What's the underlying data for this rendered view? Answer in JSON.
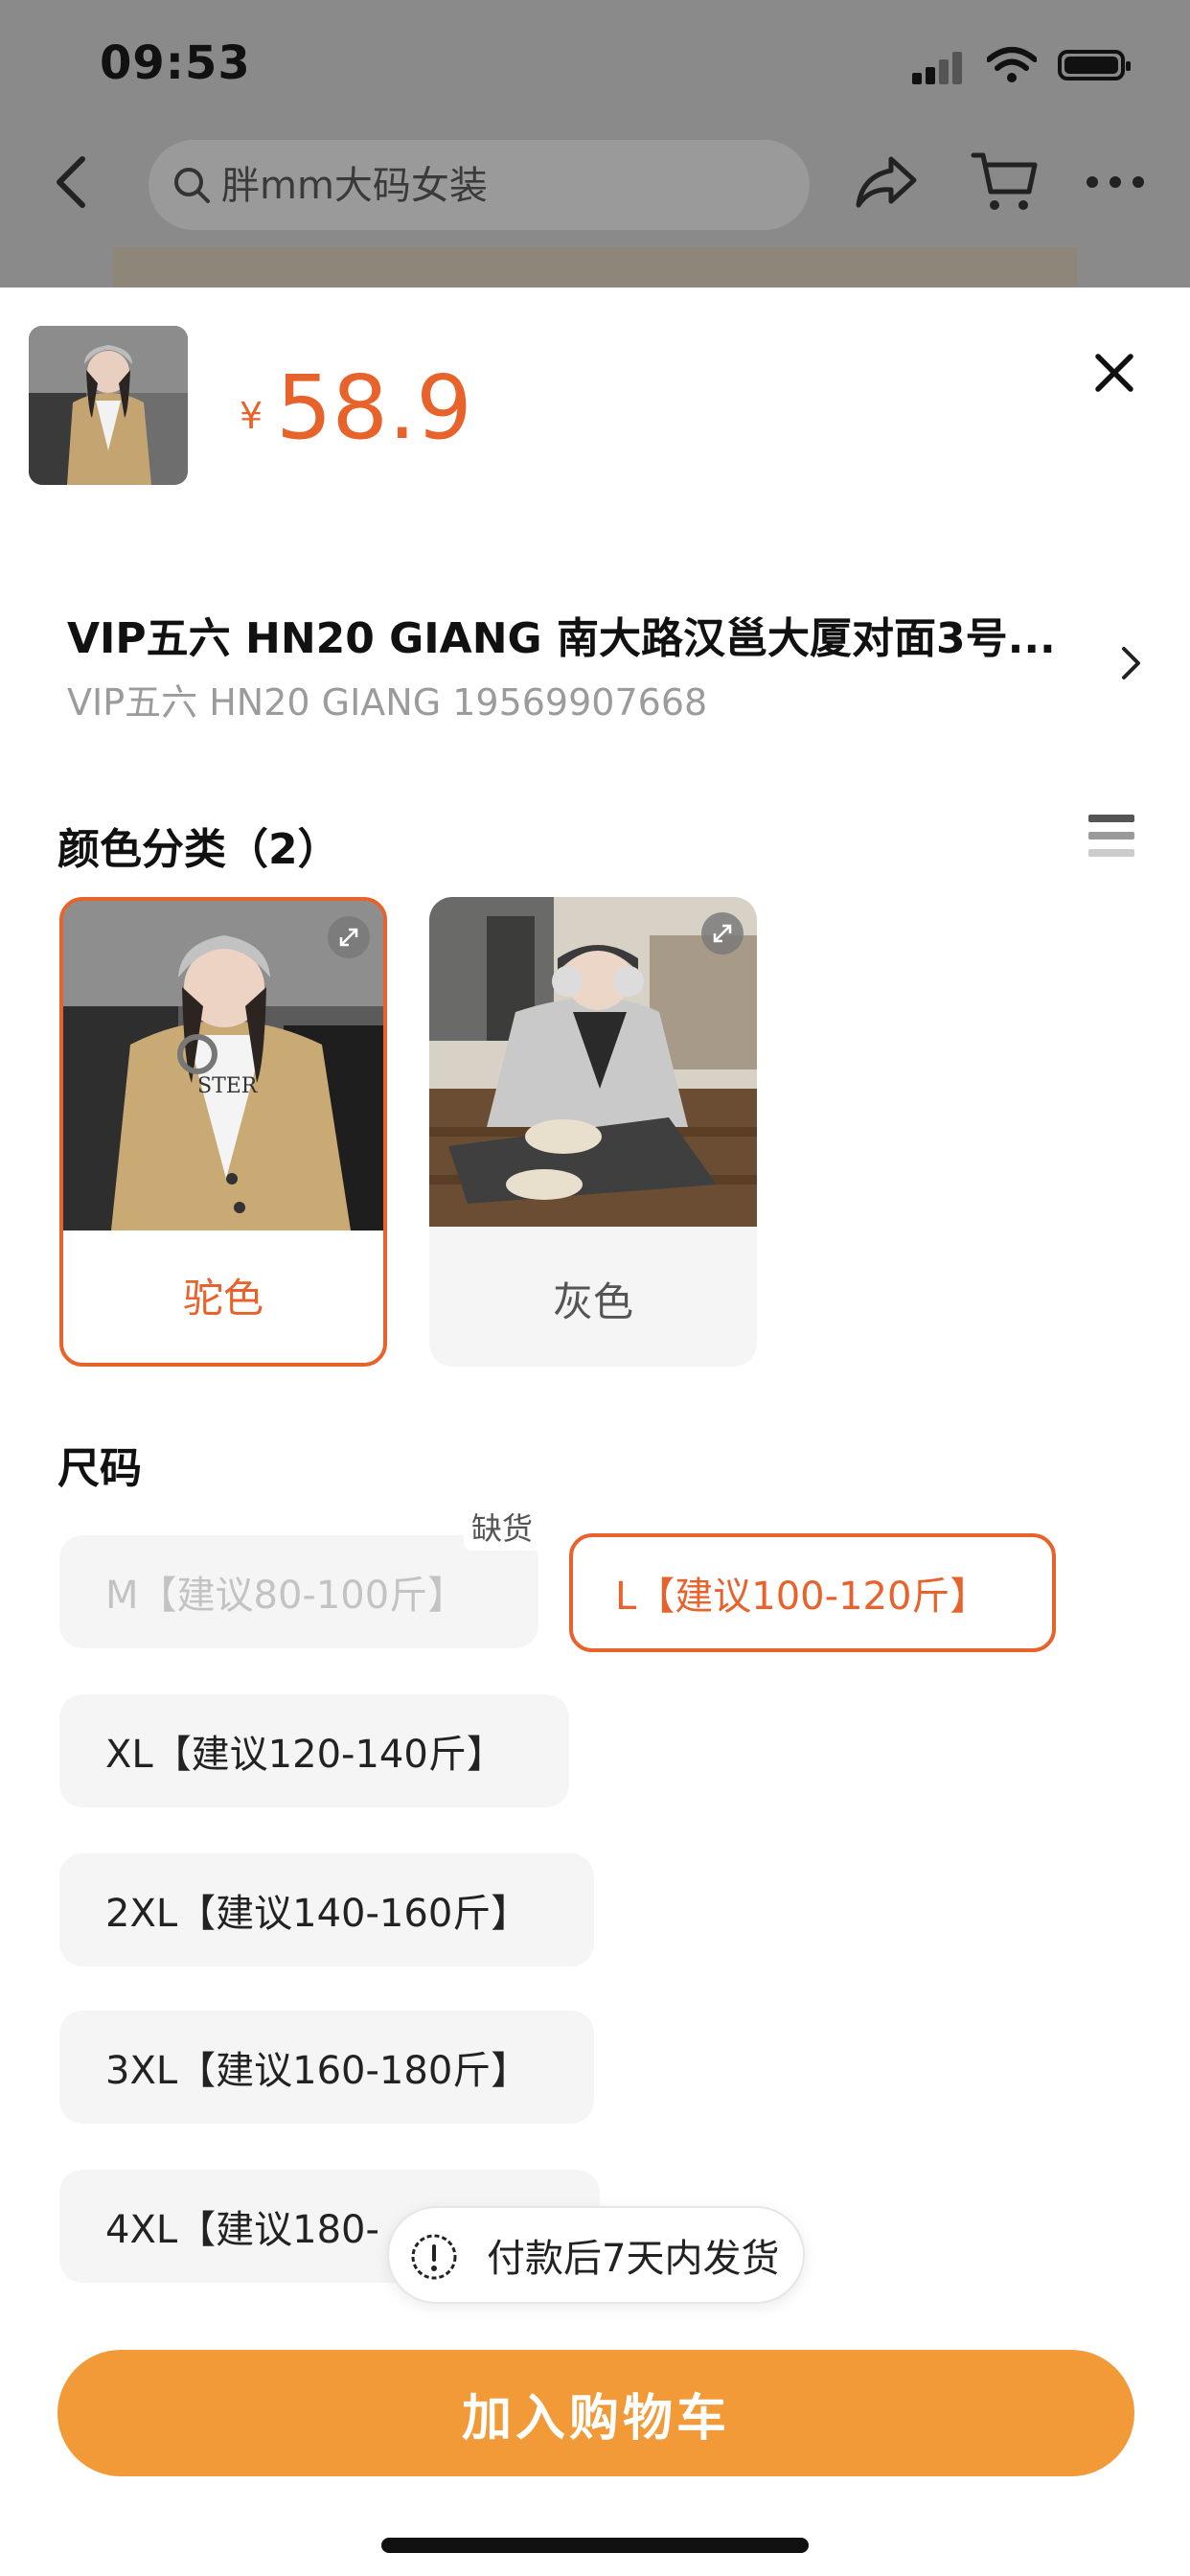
{
  "status_bar": {
    "time": "09:53"
  },
  "search": {
    "placeholder": "胖mm大码女装"
  },
  "product": {
    "currency": "¥",
    "price": "58.9"
  },
  "address": {
    "title": "VIP五六 HN20 GIANG   南大路汉邕大厦对面3号...",
    "subtitle": "VIP五六  HN20 GIANG 19569907668"
  },
  "color_section": {
    "title": "颜色分类（2）",
    "options": [
      {
        "label": "驼色",
        "selected": true
      },
      {
        "label": "灰色",
        "selected": false
      }
    ]
  },
  "size_section": {
    "title": "尺码",
    "out_of_stock_tag": "缺货",
    "options": [
      {
        "label": "M【建议80-100斤】",
        "state": "disabled"
      },
      {
        "label": "L【建议100-120斤】",
        "state": "selected"
      },
      {
        "label": "XL【建议120-140斤】",
        "state": "normal"
      },
      {
        "label": "2XL【建议140-160斤】",
        "state": "normal"
      },
      {
        "label": "3XL【建议160-180斤】",
        "state": "normal"
      },
      {
        "label": "4XL【建议180-",
        "state": "normal"
      }
    ]
  },
  "toast": {
    "text": "付款后7天内发货"
  },
  "action": {
    "add_to_cart": "加入购物车"
  },
  "colors": {
    "accent": "#e8632b",
    "button": "#f29a38",
    "chip_bg": "#f5f5f5"
  }
}
